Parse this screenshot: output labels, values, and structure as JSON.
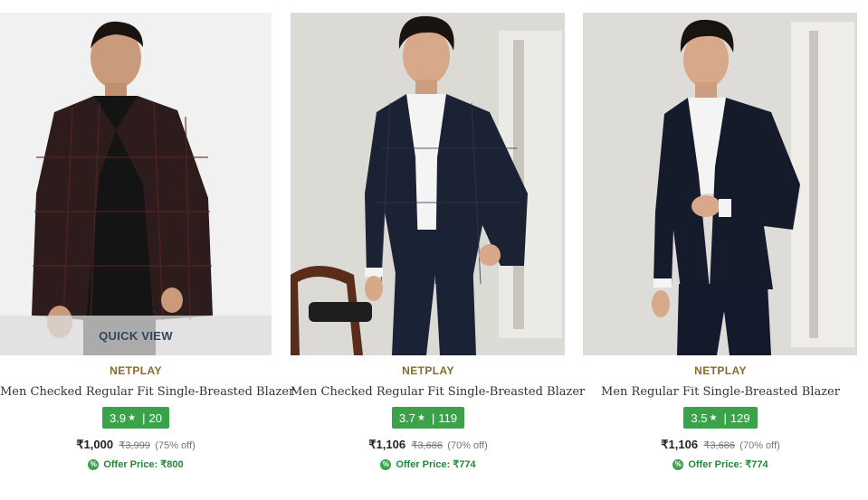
{
  "products": [
    {
      "brand": "NETPLAY",
      "name": "Men Checked Regular Fit Single-Breasted Blazer",
      "rating": "3.9",
      "reviews": "20",
      "price": "₹1,000",
      "mrp": "₹3,999",
      "discount": "(75% off)",
      "offer_price": "Offer Price: ₹800",
      "quick_view": "QUICK VIEW",
      "blazer_color": "#2e1c1c",
      "shirt_color": "#141414"
    },
    {
      "brand": "NETPLAY",
      "name": "Men Checked Regular Fit Single-Breasted Blazer",
      "rating": "3.7",
      "reviews": "119",
      "price": "₹1,106",
      "mrp": "₹3,686",
      "discount": "(70% off)",
      "offer_price": "Offer Price: ₹774",
      "blazer_color": "#1b2233",
      "shirt_color": "#f4f4f4"
    },
    {
      "brand": "NETPLAY",
      "name": "Men Regular Fit Single-Breasted Blazer",
      "rating": "3.5",
      "reviews": "129",
      "price": "₹1,106",
      "mrp": "₹3,686",
      "discount": "(70% off)",
      "offer_price": "Offer Price: ₹774",
      "blazer_color": "#161b2c",
      "shirt_color": "#f4f4f4"
    }
  ],
  "rating_star": "★",
  "rating_separator": "|",
  "colors": {
    "brand": "#8a6a2e",
    "rating_bg": "#3aa34a",
    "offer": "#1f8a3a"
  }
}
